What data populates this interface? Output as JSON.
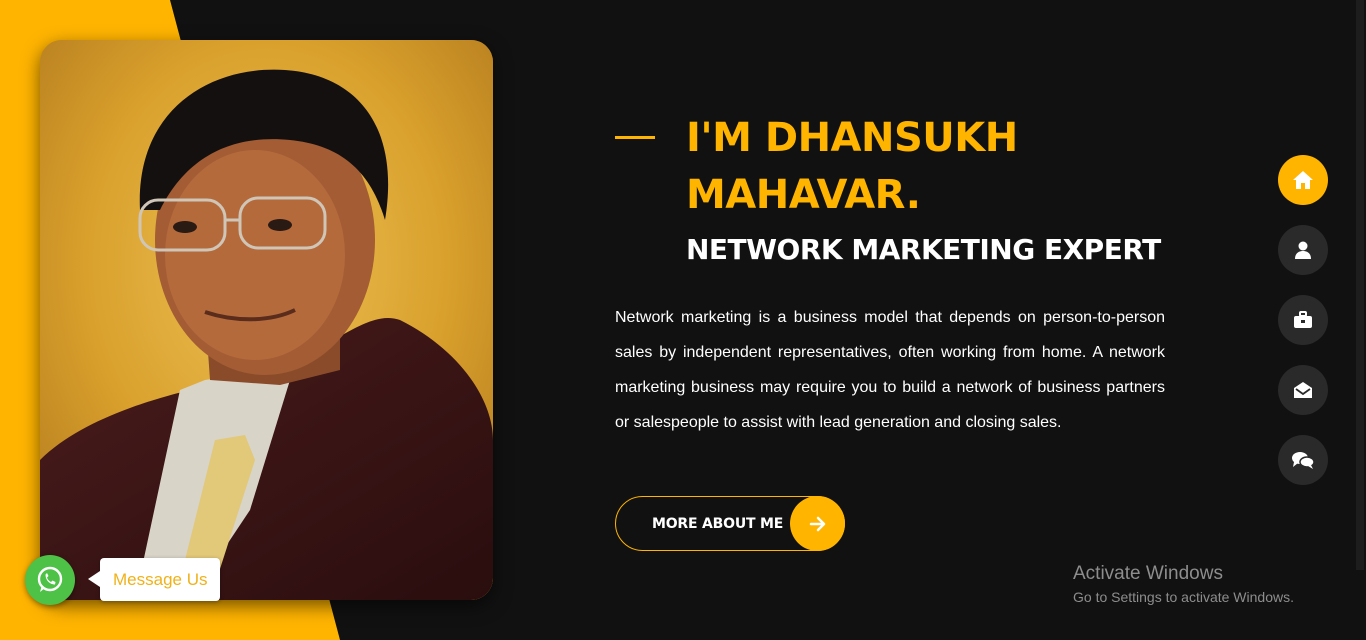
{
  "colors": {
    "accent": "#ffb400",
    "background": "#111111",
    "nav_inactive": "#2b2a2a",
    "whatsapp": "#4dc247"
  },
  "hero": {
    "title": "I'M DHANSUKH MAHAVAR.",
    "subtitle": "NETWORK MARKETING EXPERT",
    "description": "Network marketing is a business model that depends on person-to-person sales by independent representatives, often working from home. A network marketing business may require you to build a network of business partners or salespeople to assist with lead generation and closing sales.",
    "button_label": "MORE ABOUT ME",
    "button_icon": "arrow-right-icon"
  },
  "side_nav": [
    {
      "icon": "home-icon",
      "active": true
    },
    {
      "icon": "user-icon",
      "active": false
    },
    {
      "icon": "briefcase-icon",
      "active": false
    },
    {
      "icon": "envelope-open-icon",
      "active": false
    },
    {
      "icon": "comments-icon",
      "active": false
    }
  ],
  "whatsapp": {
    "icon": "whatsapp-icon",
    "message": "Message Us"
  },
  "activate_windows": {
    "title": "Activate Windows",
    "subtitle": "Go to Settings to activate Windows."
  }
}
